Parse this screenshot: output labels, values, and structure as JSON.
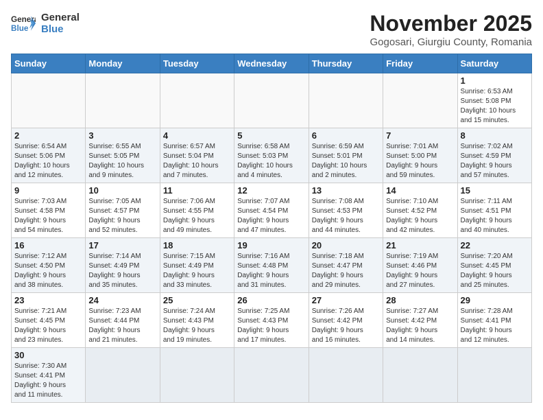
{
  "header": {
    "logo_general": "General",
    "logo_blue": "Blue",
    "month": "November 2025",
    "location": "Gogosari, Giurgiu County, Romania"
  },
  "weekdays": [
    "Sunday",
    "Monday",
    "Tuesday",
    "Wednesday",
    "Thursday",
    "Friday",
    "Saturday"
  ],
  "weeks": [
    [
      {
        "day": "",
        "info": ""
      },
      {
        "day": "",
        "info": ""
      },
      {
        "day": "",
        "info": ""
      },
      {
        "day": "",
        "info": ""
      },
      {
        "day": "",
        "info": ""
      },
      {
        "day": "",
        "info": ""
      },
      {
        "day": "1",
        "info": "Sunrise: 6:53 AM\nSunset: 5:08 PM\nDaylight: 10 hours\nand 15 minutes."
      }
    ],
    [
      {
        "day": "2",
        "info": "Sunrise: 6:54 AM\nSunset: 5:06 PM\nDaylight: 10 hours\nand 12 minutes."
      },
      {
        "day": "3",
        "info": "Sunrise: 6:55 AM\nSunset: 5:05 PM\nDaylight: 10 hours\nand 9 minutes."
      },
      {
        "day": "4",
        "info": "Sunrise: 6:57 AM\nSunset: 5:04 PM\nDaylight: 10 hours\nand 7 minutes."
      },
      {
        "day": "5",
        "info": "Sunrise: 6:58 AM\nSunset: 5:03 PM\nDaylight: 10 hours\nand 4 minutes."
      },
      {
        "day": "6",
        "info": "Sunrise: 6:59 AM\nSunset: 5:01 PM\nDaylight: 10 hours\nand 2 minutes."
      },
      {
        "day": "7",
        "info": "Sunrise: 7:01 AM\nSunset: 5:00 PM\nDaylight: 9 hours\nand 59 minutes."
      },
      {
        "day": "8",
        "info": "Sunrise: 7:02 AM\nSunset: 4:59 PM\nDaylight: 9 hours\nand 57 minutes."
      }
    ],
    [
      {
        "day": "9",
        "info": "Sunrise: 7:03 AM\nSunset: 4:58 PM\nDaylight: 9 hours\nand 54 minutes."
      },
      {
        "day": "10",
        "info": "Sunrise: 7:05 AM\nSunset: 4:57 PM\nDaylight: 9 hours\nand 52 minutes."
      },
      {
        "day": "11",
        "info": "Sunrise: 7:06 AM\nSunset: 4:55 PM\nDaylight: 9 hours\nand 49 minutes."
      },
      {
        "day": "12",
        "info": "Sunrise: 7:07 AM\nSunset: 4:54 PM\nDaylight: 9 hours\nand 47 minutes."
      },
      {
        "day": "13",
        "info": "Sunrise: 7:08 AM\nSunset: 4:53 PM\nDaylight: 9 hours\nand 44 minutes."
      },
      {
        "day": "14",
        "info": "Sunrise: 7:10 AM\nSunset: 4:52 PM\nDaylight: 9 hours\nand 42 minutes."
      },
      {
        "day": "15",
        "info": "Sunrise: 7:11 AM\nSunset: 4:51 PM\nDaylight: 9 hours\nand 40 minutes."
      }
    ],
    [
      {
        "day": "16",
        "info": "Sunrise: 7:12 AM\nSunset: 4:50 PM\nDaylight: 9 hours\nand 38 minutes."
      },
      {
        "day": "17",
        "info": "Sunrise: 7:14 AM\nSunset: 4:49 PM\nDaylight: 9 hours\nand 35 minutes."
      },
      {
        "day": "18",
        "info": "Sunrise: 7:15 AM\nSunset: 4:49 PM\nDaylight: 9 hours\nand 33 minutes."
      },
      {
        "day": "19",
        "info": "Sunrise: 7:16 AM\nSunset: 4:48 PM\nDaylight: 9 hours\nand 31 minutes."
      },
      {
        "day": "20",
        "info": "Sunrise: 7:18 AM\nSunset: 4:47 PM\nDaylight: 9 hours\nand 29 minutes."
      },
      {
        "day": "21",
        "info": "Sunrise: 7:19 AM\nSunset: 4:46 PM\nDaylight: 9 hours\nand 27 minutes."
      },
      {
        "day": "22",
        "info": "Sunrise: 7:20 AM\nSunset: 4:45 PM\nDaylight: 9 hours\nand 25 minutes."
      }
    ],
    [
      {
        "day": "23",
        "info": "Sunrise: 7:21 AM\nSunset: 4:45 PM\nDaylight: 9 hours\nand 23 minutes."
      },
      {
        "day": "24",
        "info": "Sunrise: 7:23 AM\nSunset: 4:44 PM\nDaylight: 9 hours\nand 21 minutes."
      },
      {
        "day": "25",
        "info": "Sunrise: 7:24 AM\nSunset: 4:43 PM\nDaylight: 9 hours\nand 19 minutes."
      },
      {
        "day": "26",
        "info": "Sunrise: 7:25 AM\nSunset: 4:43 PM\nDaylight: 9 hours\nand 17 minutes."
      },
      {
        "day": "27",
        "info": "Sunrise: 7:26 AM\nSunset: 4:42 PM\nDaylight: 9 hours\nand 16 minutes."
      },
      {
        "day": "28",
        "info": "Sunrise: 7:27 AM\nSunset: 4:42 PM\nDaylight: 9 hours\nand 14 minutes."
      },
      {
        "day": "29",
        "info": "Sunrise: 7:28 AM\nSunset: 4:41 PM\nDaylight: 9 hours\nand 12 minutes."
      }
    ],
    [
      {
        "day": "30",
        "info": "Sunrise: 7:30 AM\nSunset: 4:41 PM\nDaylight: 9 hours\nand 11 minutes."
      },
      {
        "day": "",
        "info": ""
      },
      {
        "day": "",
        "info": ""
      },
      {
        "day": "",
        "info": ""
      },
      {
        "day": "",
        "info": ""
      },
      {
        "day": "",
        "info": ""
      },
      {
        "day": "",
        "info": ""
      }
    ]
  ]
}
